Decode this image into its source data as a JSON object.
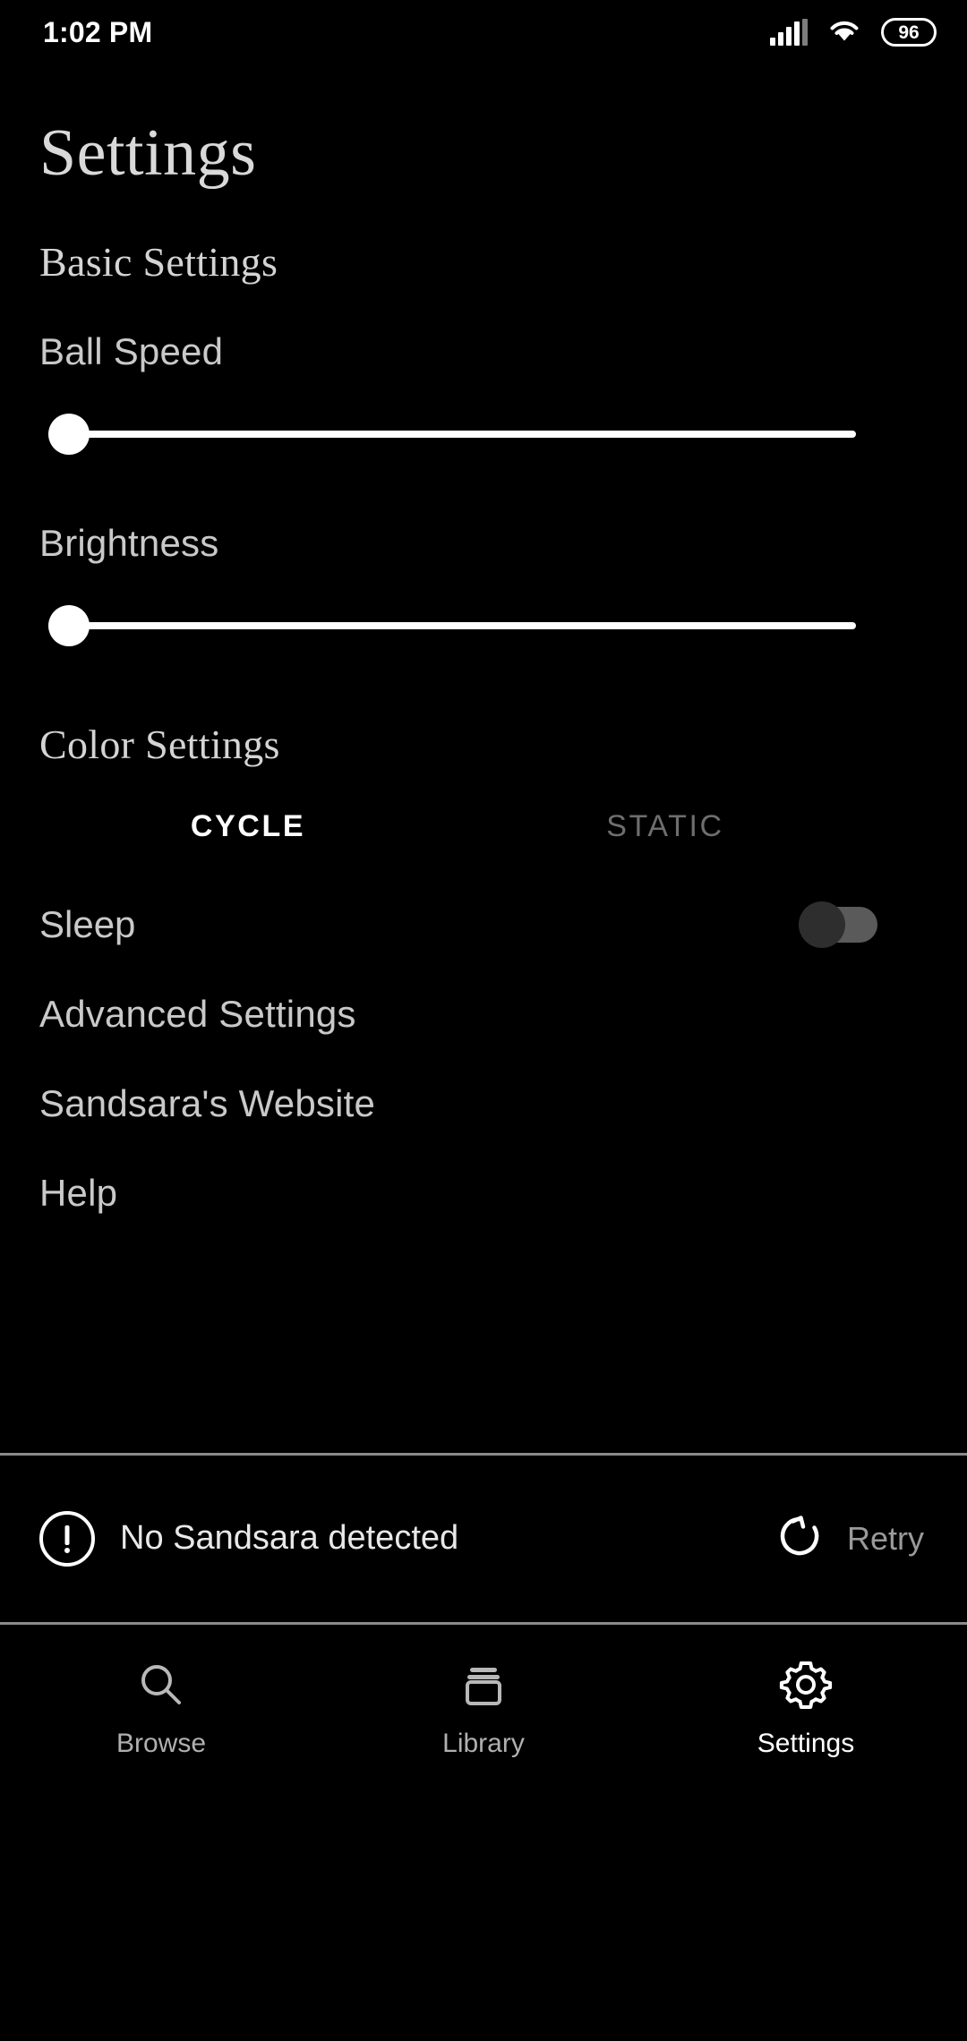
{
  "status_bar": {
    "time": "1:02 PM",
    "signal_icon": "cellular-signal-icon",
    "wifi_icon": "wifi-icon",
    "battery_level": "96"
  },
  "header": {
    "title": "Settings"
  },
  "basic_settings": {
    "heading": "Basic Settings",
    "ball_speed": {
      "label": "Ball Speed",
      "value_percent": 0
    },
    "brightness": {
      "label": "Brightness",
      "value_percent": 0
    }
  },
  "color_settings": {
    "heading": "Color Settings",
    "tabs": [
      {
        "label": "CYCLE",
        "active": true
      },
      {
        "label": "STATIC",
        "active": false
      }
    ]
  },
  "sleep": {
    "label": "Sleep",
    "enabled": false
  },
  "menu": [
    {
      "label": "Advanced Settings"
    },
    {
      "label": "Sandsara's Website"
    },
    {
      "label": "Help"
    }
  ],
  "device_status": {
    "alert_icon": "exclamation-circle-icon",
    "message": "No Sandsara detected",
    "retry_icon": "refresh-icon",
    "retry_label": "Retry"
  },
  "bottom_nav": [
    {
      "label": "Browse",
      "icon": "search-icon",
      "active": false
    },
    {
      "label": "Library",
      "icon": "library-icon",
      "active": false
    },
    {
      "label": "Settings",
      "icon": "gear-icon",
      "active": true
    }
  ],
  "colors": {
    "background": "#000000",
    "primary_text": "#d9d9d9",
    "accent": "#ffffff",
    "muted_text": "#6e6e6e",
    "divider": "#8a8a8a"
  }
}
